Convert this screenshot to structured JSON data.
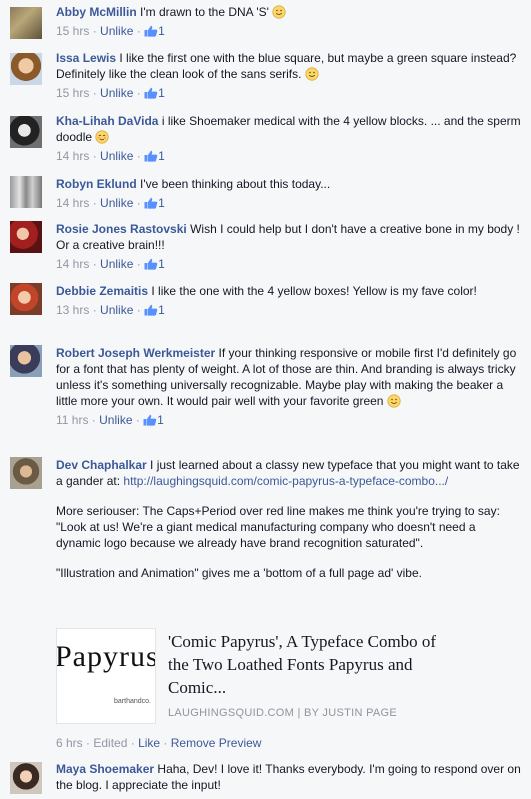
{
  "comments": [
    {
      "name": "Abby McMillin",
      "text": "I'm drawn to the DNA 'S'",
      "time": "15 hrs",
      "action": "Unlike",
      "likes": "1"
    },
    {
      "name": "Issa Lewis",
      "text": "I like the first one with the blue square, but maybe a green square instead? Definitely like the clean look of the sans serifs.",
      "time": "15 hrs",
      "action": "Unlike",
      "likes": "1"
    },
    {
      "name": "Kha-Lihah DaVida",
      "text": "i like Shoemaker medical with the 4 yellow blocks. ... and the sperm doodle",
      "time": "14 hrs",
      "action": "Unlike",
      "likes": "1"
    },
    {
      "name": "Robyn Eklund",
      "text": "I've been thinking about this today...",
      "time": "14 hrs",
      "action": "Unlike",
      "likes": "1"
    },
    {
      "name": "Rosie Jones Rastovski",
      "text": "Wish I could help but I don't have a creative bone in my body ! Or a creative brain!!!",
      "time": "14 hrs",
      "action": "Unlike",
      "likes": "1"
    },
    {
      "name": "Debbie Zemaitis",
      "text": "I like the one with the 4 yellow boxes! Yellow is my fave color!",
      "time": "13 hrs",
      "action": "Unlike",
      "likes": "1"
    },
    {
      "name": "Robert Joseph Werkmeister",
      "text": "If your thinking responsive or mobile first I'd definitely go for a font that has plenty of weight. A lot of those are thin. And branding is always tricky unless it's something universally recognizable. Maybe play with making the beaker a little more your own. It would pair well with your favorite green",
      "time": "11 hrs",
      "action": "Unlike",
      "likes": "1"
    },
    {
      "name": "Dev Chaphalkar",
      "text": "I just learned about a classy new typeface that you might want to take a gander at:",
      "link": "http://laughingsquid.com/comic-papyrus-a-typeface-combo.../",
      "para2": "More seriouser: The Caps+Period over red line makes me think you're trying to say: \"Look at us! We're a giant medical manufacturing company who doesn't need a dynamic logo because we already have brand recognition saturated\".",
      "para3": "\"Illustration and Animation\" gives me a 'bottom of a full page ad' vibe.",
      "preview": {
        "image_word": "Papyrus",
        "image_caption": "barthandco.",
        "title": "'Comic Papyrus', A Typeface Combo of the Two Loathed Fonts Papyrus and Comic...",
        "source": "LAUGHINGSQUID.COM   |   BY JUSTIN PAGE"
      },
      "time": "6 hrs",
      "edited": "Edited",
      "like": "Like",
      "remove_preview": "Remove Preview"
    },
    {
      "name": "Maya Shoemaker",
      "text": "Haha, Dev! I love it! Thanks everybody. I'm going to respond over on the blog. I appreciate the input!"
    }
  ],
  "separator": " · ",
  "colors": {
    "link": "#3b5998",
    "meta": "#9197a3",
    "text": "#141823"
  }
}
